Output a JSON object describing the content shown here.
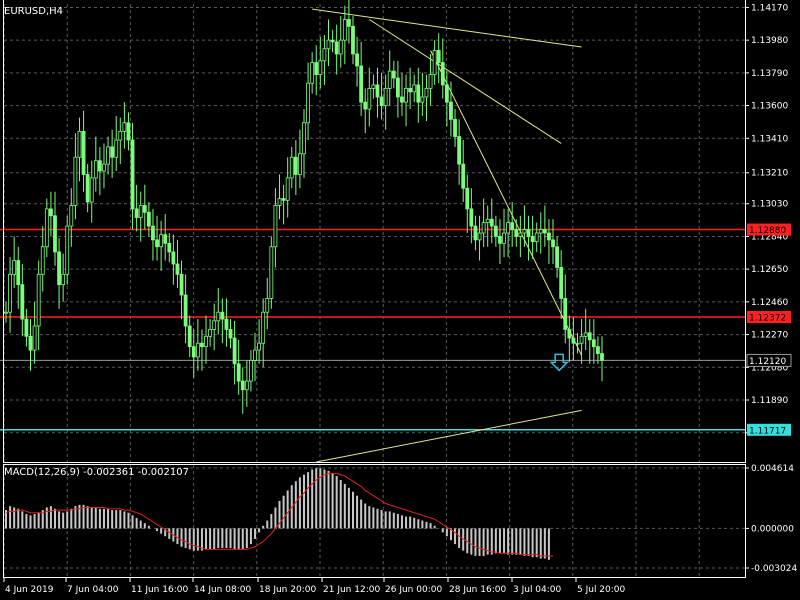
{
  "window": {
    "symbol_title": "EURUSD,H4",
    "indicator_title": "MACD(12,26,9) -0.002361 -0.002107"
  },
  "colors": {
    "background": "#000000",
    "grid": "#5a5a5a",
    "candle": "#7CFC7C",
    "frame": "#ffffff",
    "resistance": "#ff2020",
    "support": "#33e0e0",
    "trendline": "#e6e68a",
    "current_price": "#9a9a9a",
    "macd_hist": "#c8c8c8",
    "macd_signal": "#e02020",
    "arrow": "#33c0e0"
  },
  "icons": {
    "signal_arrow": "down-arrow-icon"
  },
  "chart_data": {
    "type": "candlestick",
    "y_ticks": [
      "1.14170",
      "1.13980",
      "1.13790",
      "1.13600",
      "1.13410",
      "1.13210",
      "1.13030",
      "1.12840",
      "1.12650",
      "1.12460",
      "1.12270",
      "1.12080",
      "1.11890",
      "1.11700"
    ],
    "x_ticks": [
      "4 Jun 2019",
      "7 Jun 04:00",
      "11 Jun 16:00",
      "14 Jun 08:00",
      "18 Jun 20:00",
      "21 Jun 12:00",
      "26 Jun 00:00",
      "28 Jun 16:00",
      "3 Jul 04:00",
      "5 Jul 20:00"
    ],
    "ylim": [
      1.1153,
      1.1419
    ],
    "close_series": [
      1.124,
      1.1262,
      1.127,
      1.1256,
      1.1236,
      1.1226,
      1.1218,
      1.1232,
      1.1262,
      1.1278,
      1.13,
      1.1296,
      1.1275,
      1.1256,
      1.1262,
      1.129,
      1.1302,
      1.133,
      1.1345,
      1.132,
      1.1304,
      1.1318,
      1.1328,
      1.1322,
      1.1326,
      1.1336,
      1.133,
      1.134,
      1.1345,
      1.135,
      1.134,
      1.13,
      1.1295,
      1.1302,
      1.1298,
      1.129,
      1.1282,
      1.1278,
      1.1285,
      1.128,
      1.1275,
      1.1268,
      1.1262,
      1.125,
      1.1232,
      1.122,
      1.1214,
      1.1222,
      1.122,
      1.1226,
      1.123,
      1.1235,
      1.124,
      1.1236,
      1.123,
      1.1225,
      1.121,
      1.12,
      1.1195,
      1.12,
      1.1212,
      1.1218,
      1.1222,
      1.124,
      1.1248,
      1.1278,
      1.1302,
      1.1306,
      1.1305,
      1.1318,
      1.133,
      1.132,
      1.1332,
      1.135,
      1.1373,
      1.1385,
      1.1378,
      1.1386,
      1.1393,
      1.1398,
      1.1397,
      1.139,
      1.1398,
      1.141,
      1.1406,
      1.139,
      1.1383,
      1.1362,
      1.1358,
      1.137,
      1.1372,
      1.1365,
      1.136,
      1.137,
      1.138,
      1.1376,
      1.1365,
      1.1362,
      1.137,
      1.1368,
      1.1372,
      1.1362,
      1.1365,
      1.137,
      1.1378,
      1.1392,
      1.1385,
      1.1372,
      1.1362,
      1.1352,
      1.1342,
      1.1326,
      1.1312,
      1.13,
      1.129,
      1.1282,
      1.1286,
      1.1292,
      1.1294,
      1.129,
      1.1284,
      1.128,
      1.1286,
      1.1292,
      1.1288,
      1.1284,
      1.1286,
      1.1288,
      1.1284,
      1.1281,
      1.1286,
      1.1288,
      1.1286,
      1.1282,
      1.1278,
      1.1266,
      1.1248,
      1.123,
      1.1225,
      1.1222,
      1.1222,
      1.1226,
      1.1228,
      1.1224,
      1.122,
      1.1216,
      1.1212
    ],
    "macd_hist": [
      0.0014,
      0.0017,
      0.0016,
      0.0015,
      0.0013,
      0.0011,
      0.001,
      0.0011,
      0.0012,
      0.0014,
      0.0016,
      0.0017,
      0.0015,
      0.0013,
      0.0012,
      0.0013,
      0.0015,
      0.0017,
      0.0018,
      0.0018,
      0.0017,
      0.0016,
      0.0016,
      0.0015,
      0.0015,
      0.0015,
      0.0014,
      0.0014,
      0.0014,
      0.0013,
      0.0012,
      0.001,
      0.0008,
      0.0006,
      0.0004,
      0.0002,
      0.0,
      -0.0002,
      -0.0004,
      -0.0006,
      -0.0008,
      -0.001,
      -0.0012,
      -0.0014,
      -0.0015,
      -0.0016,
      -0.0017,
      -0.0017,
      -0.0017,
      -0.0016,
      -0.0016,
      -0.0016,
      -0.0015,
      -0.0015,
      -0.0015,
      -0.0015,
      -0.0016,
      -0.0016,
      -0.0016,
      -0.0015,
      -0.0012,
      -0.0008,
      -0.0003,
      0.0002,
      0.0006,
      0.0011,
      0.0016,
      0.0021,
      0.0025,
      0.0029,
      0.0033,
      0.0036,
      0.0039,
      0.0041,
      0.0043,
      0.0045,
      0.0046,
      0.0046,
      0.0045,
      0.0044,
      0.0042,
      0.004,
      0.0037,
      0.0034,
      0.0031,
      0.0028,
      0.0025,
      0.0022,
      0.0019,
      0.0017,
      0.0016,
      0.0015,
      0.0014,
      0.0013,
      0.0013,
      0.0012,
      0.0011,
      0.001,
      0.0009,
      0.0009,
      0.0008,
      0.0007,
      0.0006,
      0.0005,
      0.0004,
      0.0002,
      0.0,
      -0.0003,
      -0.0006,
      -0.0009,
      -0.0012,
      -0.0015,
      -0.0017,
      -0.0019,
      -0.002,
      -0.0021,
      -0.0021,
      -0.0021,
      -0.002,
      -0.002,
      -0.0019,
      -0.0019,
      -0.0019,
      -0.002,
      -0.002,
      -0.002,
      -0.002,
      -0.0021,
      -0.0021,
      -0.0022,
      -0.0022,
      -0.0023,
      -0.0023,
      -0.0024
    ],
    "macd_signal": [
      0.0012,
      0.0013,
      0.0013,
      0.0014,
      0.0014,
      0.0013,
      0.0012,
      0.0012,
      0.0012,
      0.0012,
      0.0013,
      0.0013,
      0.0014,
      0.0014,
      0.0014,
      0.0014,
      0.0014,
      0.0015,
      0.0015,
      0.0016,
      0.0016,
      0.0016,
      0.0016,
      0.0016,
      0.0016,
      0.0015,
      0.0015,
      0.0015,
      0.0015,
      0.0014,
      0.0014,
      0.0013,
      0.0012,
      0.0011,
      0.0009,
      0.0007,
      0.0005,
      0.0003,
      0.0001,
      -0.0001,
      -0.0003,
      -0.0005,
      -0.0007,
      -0.0009,
      -0.001,
      -0.0012,
      -0.0013,
      -0.0014,
      -0.0015,
      -0.0016,
      -0.0016,
      -0.0016,
      -0.0016,
      -0.0016,
      -0.0016,
      -0.0016,
      -0.0016,
      -0.0016,
      -0.0016,
      -0.0016,
      -0.0015,
      -0.0014,
      -0.0012,
      -0.001,
      -0.0007,
      -0.0004,
      0.0,
      0.0004,
      0.0008,
      0.0012,
      0.0016,
      0.002,
      0.0024,
      0.0027,
      0.0031,
      0.0034,
      0.0037,
      0.0039,
      0.0041,
      0.0042,
      0.0042,
      0.0042,
      0.0041,
      0.004,
      0.0038,
      0.0036,
      0.0034,
      0.0032,
      0.0029,
      0.0027,
      0.0025,
      0.0023,
      0.0021,
      0.0019,
      0.0018,
      0.0017,
      0.0016,
      0.0015,
      0.0014,
      0.0013,
      0.0012,
      0.0011,
      0.001,
      0.0009,
      0.0008,
      0.0007,
      0.0005,
      0.0003,
      0.0001,
      -0.0001,
      -0.0003,
      -0.0006,
      -0.0008,
      -0.001,
      -0.0012,
      -0.0014,
      -0.0015,
      -0.0016,
      -0.0017,
      -0.0018,
      -0.0018,
      -0.0019,
      -0.0019,
      -0.0019,
      -0.0019,
      -0.0019,
      -0.002,
      -0.002,
      -0.002,
      -0.002,
      -0.002,
      -0.0021,
      -0.0021,
      -0.0021,
      -0.0021
    ],
    "macd_ticks": [
      "0.004614",
      "0.000000",
      "-0.003024"
    ],
    "macd_ylim": [
      -0.003024,
      0.004614
    ],
    "horizontal_levels": [
      {
        "name": "resistance-upper",
        "price": 1.1288,
        "label": "1.12880",
        "color": "#ff2020"
      },
      {
        "name": "resistance-lower",
        "price": 1.12372,
        "label": "1.12372",
        "color": "#ff2020"
      },
      {
        "name": "support",
        "price": 1.11717,
        "label": "1.11717",
        "color": "#33e0e0"
      }
    ],
    "current_price": {
      "price": 1.1212,
      "label": "1.12120"
    },
    "trendlines": [
      {
        "name": "trendline-top-flat",
        "from": {
          "bar": 75,
          "price": 1.1416
        },
        "to": {
          "bar": 141,
          "price": 1.1394
        }
      },
      {
        "name": "trendline-top-mid",
        "from": {
          "bar": 89,
          "price": 1.141
        },
        "to": {
          "bar": 136,
          "price": 1.1338
        }
      },
      {
        "name": "trendline-steep",
        "from": {
          "bar": 104,
          "price": 1.1392
        },
        "to": {
          "bar": 141,
          "price": 1.1215
        }
      },
      {
        "name": "trendline-support",
        "from": {
          "bar": 76,
          "price": 1.1153
        },
        "to": {
          "bar": 141,
          "price": 1.1183
        }
      }
    ],
    "signal_arrow": {
      "bar": 136,
      "price": 1.1212,
      "direction": "down"
    }
  }
}
